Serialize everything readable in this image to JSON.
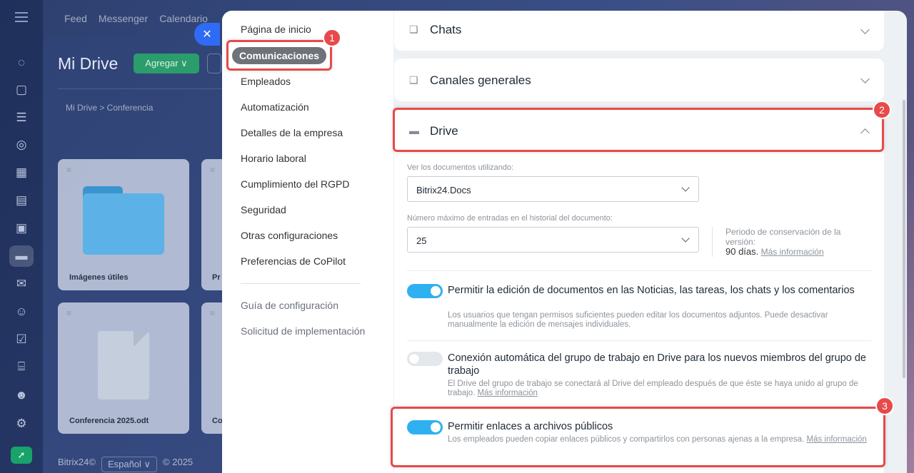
{
  "background": {
    "topnav": [
      "Feed",
      "Messenger",
      "Calendario"
    ],
    "page_title": "Mi Drive",
    "add_button": "Agregar ∨",
    "breadcrumb": "Mi Drive  >  Conferencia",
    "tiles": [
      {
        "name": "Imágenes útiles"
      },
      {
        "name": "Pr"
      },
      {
        "name": "Conferencia 2025.odt"
      },
      {
        "name": "Co"
      }
    ],
    "footer": {
      "brand": "Bitrix24©",
      "language": "Español ∨",
      "copyright": "© 2025"
    }
  },
  "close_label": "✕",
  "settings_nav": {
    "items": [
      "Página de inicio",
      "Comunicaciones",
      "Empleados",
      "Automatización",
      "Detalles de la empresa",
      "Horario laboral",
      "Cumplimiento del RGPD",
      "Seguridad",
      "Otras configuraciones",
      "Preferencias de CoPilot"
    ],
    "secondary": [
      "Guía de configuración",
      "Solicitud de implementación"
    ]
  },
  "sections": {
    "chats": "Chats",
    "canales": "Canales generales",
    "drive": "Drive"
  },
  "drive": {
    "viewer_label": "Ver los documentos utilizando:",
    "viewer_value": "Bitrix24.Docs",
    "history_label": "Número máximo de entradas en el historial del documento:",
    "history_value": "25",
    "retention_label": "Periodo de conservación de la versión:",
    "retention_value": "90 días.",
    "retention_link": "Más información",
    "options": [
      {
        "title": "Permitir la edición de documentos en las Noticias, las tareas, los chats y los comentarios",
        "desc": "Los usuarios que tengan permisos suficientes pueden editar los documentos adjuntos. Puede desactivar manualmente la edición de mensajes individuales.",
        "link": "",
        "enabled": true
      },
      {
        "title": "Conexión automática del grupo de trabajo en Drive para los nuevos miembros del grupo de trabajo",
        "desc": "El Drive del grupo de trabajo se conectará al Drive del empleado después de que éste se haya unido al grupo de trabajo.",
        "link": "Más información",
        "enabled": false
      },
      {
        "title": "Permitir enlaces a archivos públicos",
        "desc": "Los empleados pueden copiar enlaces públicos y compartirlos con personas ajenas a la empresa.",
        "link": "Más información",
        "enabled": true
      }
    ]
  },
  "callouts": [
    "1",
    "2",
    "3"
  ],
  "colors": {
    "accent_blue": "#2fb0f0",
    "callout_red": "#e64a4a",
    "close_blue": "#2f6bf5"
  }
}
